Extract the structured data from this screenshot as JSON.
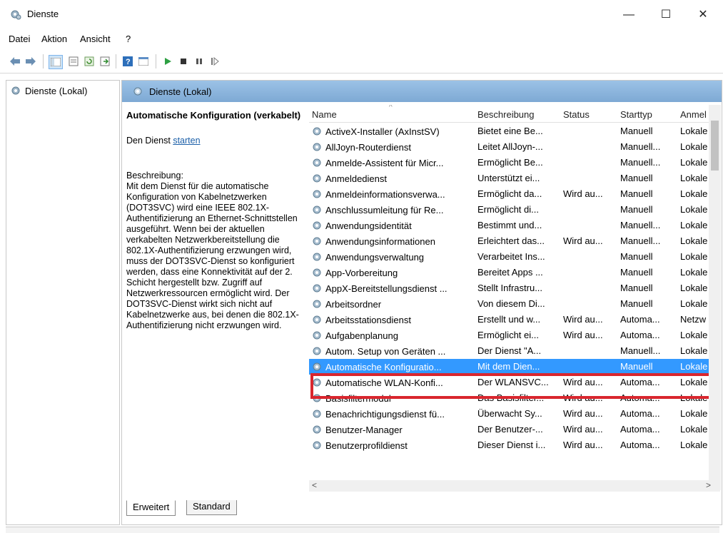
{
  "window": {
    "title": "Dienste",
    "minimize": "—",
    "maximize": "☐",
    "close": "✕"
  },
  "menu": [
    {
      "label": "Datei"
    },
    {
      "label": "Aktion"
    },
    {
      "label": "Ansicht"
    },
    {
      "label": "?"
    }
  ],
  "tree": {
    "item": "Dienste (Lokal)"
  },
  "main": {
    "header": "Dienste (Lokal)",
    "desc_title": "Automatische Konfiguration (verkabelt)",
    "desc_start_prefix": "Den Dienst ",
    "desc_start_link": "starten",
    "desc_label": "Beschreibung:",
    "desc_body": "Mit dem Dienst für die automatische Konfiguration von Kabelnetzwerken (DOT3SVC) wird eine IEEE 802.1X-Authentifizierung an Ethernet-Schnittstellen ausgeführt. Wenn bei der aktuellen verkabelten Netzwerkbereitstellung die 802.1X-Authentifizierung erzwungen wird, muss der DOT3SVC-Dienst so konfiguriert werden, dass eine Konnektivität auf der 2. Schicht hergestellt bzw. Zugriff auf Netzwerkressourcen ermöglicht wird. Der DOT3SVC-Dienst wirkt sich nicht auf Kabelnetzwerke aus, bei denen die 802.1X-Authentifizierung nicht erzwungen wird."
  },
  "columns": {
    "name": "Name",
    "desc": "Beschreibung",
    "status": "Status",
    "start": "Starttyp",
    "logon": "Anmel"
  },
  "rows": [
    {
      "name": "ActiveX-Installer (AxInstSV)",
      "desc": "Bietet eine Be...",
      "status": "",
      "start": "Manuell",
      "logon": "Lokale"
    },
    {
      "name": "AllJoyn-Routerdienst",
      "desc": "Leitet AllJoyn-...",
      "status": "",
      "start": "Manuell...",
      "logon": "Lokale"
    },
    {
      "name": "Anmelde-Assistent für Micr...",
      "desc": "Ermöglicht Be...",
      "status": "",
      "start": "Manuell...",
      "logon": "Lokale"
    },
    {
      "name": "Anmeldedienst",
      "desc": "Unterstützt ei...",
      "status": "",
      "start": "Manuell",
      "logon": "Lokale"
    },
    {
      "name": "Anmeldeinformationsverwa...",
      "desc": "Ermöglicht da...",
      "status": "Wird au...",
      "start": "Manuell",
      "logon": "Lokale"
    },
    {
      "name": "Anschlussumleitung für Re...",
      "desc": "Ermöglicht di...",
      "status": "",
      "start": "Manuell",
      "logon": "Lokale"
    },
    {
      "name": "Anwendungsidentität",
      "desc": "Bestimmt und...",
      "status": "",
      "start": "Manuell...",
      "logon": "Lokale"
    },
    {
      "name": "Anwendungsinformationen",
      "desc": "Erleichtert das...",
      "status": "Wird au...",
      "start": "Manuell...",
      "logon": "Lokale"
    },
    {
      "name": "Anwendungsverwaltung",
      "desc": "Verarbeitet Ins...",
      "status": "",
      "start": "Manuell",
      "logon": "Lokale"
    },
    {
      "name": "App-Vorbereitung",
      "desc": "Bereitet Apps ...",
      "status": "",
      "start": "Manuell",
      "logon": "Lokale"
    },
    {
      "name": "AppX-Bereitstellungsdienst ...",
      "desc": "Stellt Infrastru...",
      "status": "",
      "start": "Manuell",
      "logon": "Lokale"
    },
    {
      "name": "Arbeitsordner",
      "desc": "Von diesem Di...",
      "status": "",
      "start": "Manuell",
      "logon": "Lokale"
    },
    {
      "name": "Arbeitsstationsdienst",
      "desc": "Erstellt und w...",
      "status": "Wird au...",
      "start": "Automa...",
      "logon": "Netzw"
    },
    {
      "name": "Aufgabenplanung",
      "desc": "Ermöglicht ei...",
      "status": "Wird au...",
      "start": "Automa...",
      "logon": "Lokale"
    },
    {
      "name": "Autom. Setup von Geräten ...",
      "desc": "Der Dienst \"A...",
      "status": "",
      "start": "Manuell...",
      "logon": "Lokale"
    },
    {
      "name": "Automatische Konfiguratio...",
      "desc": "Mit dem Dien...",
      "status": "",
      "start": "Manuell",
      "logon": "Lokale"
    },
    {
      "name": "Automatische WLAN-Konfi...",
      "desc": "Der WLANSVC...",
      "status": "Wird au...",
      "start": "Automa...",
      "logon": "Lokale"
    },
    {
      "name": "Basisfiltermodul",
      "desc": "Das Basisfilter...",
      "status": "Wird au...",
      "start": "Automa...",
      "logon": "Lokale"
    },
    {
      "name": "Benachrichtigungsdienst fü...",
      "desc": "Überwacht Sy...",
      "status": "Wird au...",
      "start": "Automa...",
      "logon": "Lokale"
    },
    {
      "name": "Benutzer-Manager",
      "desc": "Der Benutzer-...",
      "status": "Wird au...",
      "start": "Automa...",
      "logon": "Lokale"
    },
    {
      "name": "Benutzerprofildienst",
      "desc": "Dieser Dienst i...",
      "status": "Wird au...",
      "start": "Automa...",
      "logon": "Lokale"
    }
  ],
  "selected_index": 15,
  "tabs": [
    {
      "label": "Erweitert"
    },
    {
      "label": "Standard"
    }
  ],
  "scroll": {
    "left": "<",
    "right": ">"
  },
  "colors": {
    "selection": "#3399ff",
    "highlight_border": "#d9262e",
    "header": "#9cc2e6"
  }
}
